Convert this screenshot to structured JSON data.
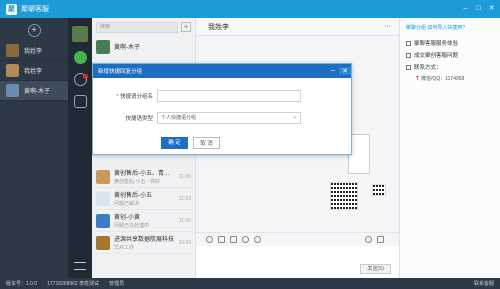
{
  "app": {
    "title": "聚聊客服",
    "logo": "聚"
  },
  "left_accounts": [
    {
      "label": "我姓李"
    },
    {
      "label": "我姓李"
    },
    {
      "label": "黄啊-木子"
    }
  ],
  "search": {
    "placeholder": "搜索"
  },
  "conversations": [
    {
      "name": "黄啊-木子",
      "preview": "黄啊-木子",
      "time": ""
    },
    {
      "name": "黄创售后-小五、青...",
      "preview": "黄创售后-小五 · 你好",
      "time": "11:06"
    },
    {
      "name": "黄创售后-小五",
      "preview": "问题已解决",
      "time": "11:03"
    },
    {
      "name": "黄创-小黄",
      "preview": "问题已在处理中",
      "time": "11:00"
    },
    {
      "name": "进源共享数据航展科技",
      "preview": "早点工作",
      "time": "10:59"
    }
  ],
  "chat": {
    "title": "我姓李",
    "more": "···",
    "send_label": "发送(S)"
  },
  "info": {
    "links": "聚聊分组   如何导入快捷用?",
    "items": [
      "聚聊客服服务体验",
      "成交聚创客服问题",
      "联系方式："
    ],
    "contact": "微信/QQ：1174958"
  },
  "modal": {
    "title": "新增快捷回复分组",
    "name_label": "快捷语分组名",
    "type_label": "快捷语类型",
    "type_value": "个人快捷语分组",
    "ok_label": "确 定",
    "cancel_label": "取 消"
  },
  "status": {
    "version": "版本号：1.0.0",
    "phone": "17718268962 李姓测试",
    "role": "管理员",
    "right": "联系客服"
  },
  "colors": {
    "brand": "#1d9bd8",
    "sidebar": "#2d3947",
    "rail": "#1f2a35",
    "modal_header": "#1d6ec0"
  }
}
